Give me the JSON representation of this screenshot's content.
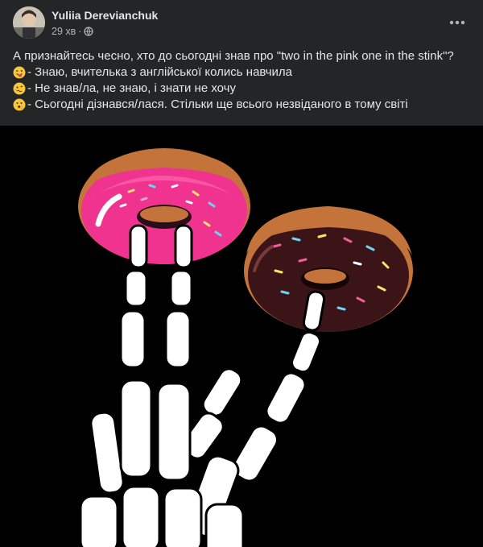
{
  "post": {
    "author": "Yuliia Derevianchuk",
    "time": "29 хв",
    "separator": "·",
    "privacy_icon": "globe-icon",
    "more_icon": "more-options-icon",
    "body": [
      "А признайтесь чесно, хто до сьогодні знав про \"two in the pink one in the stink\"?",
      "- Знаю, вчителька з англійської колись навчила",
      "- Не знав/ла, не знаю, і знати не хочу",
      "- Сьогодні дізнався/лася. Стільки ще всього незвіданого в тому світі"
    ],
    "emojis": [
      "winking-tongue-emoji",
      "woozy-face-emoji",
      "shushing-face-emoji"
    ],
    "image": {
      "description_icon": "skeleton-hand-donuts-image",
      "background": "#000000",
      "pink_glaze": "#f0338f",
      "chocolate_glaze": "#3b1418",
      "dough": "#c4743a"
    }
  }
}
